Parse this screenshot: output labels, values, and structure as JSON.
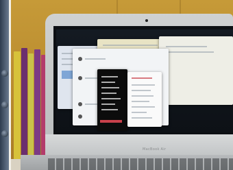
{
  "scene": {
    "laptop_brand": "MacBook Air"
  },
  "colors": {
    "wall": "#b88a2e",
    "laptop": "#c9cbcc",
    "screen": "#0d1116",
    "accent_red": "#c9414b"
  }
}
